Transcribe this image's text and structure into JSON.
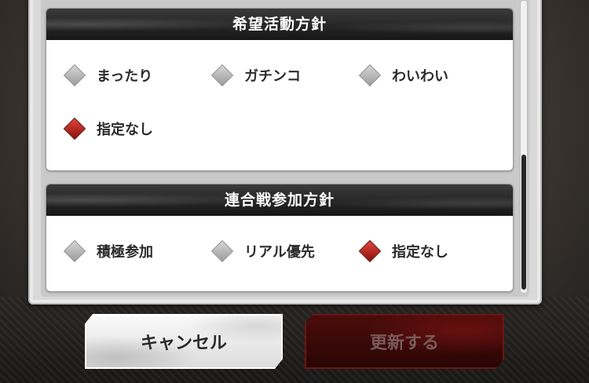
{
  "activity_policy": {
    "title": "希望活動方針",
    "options": [
      {
        "label": "まったり",
        "selected": false
      },
      {
        "label": "ガチンコ",
        "selected": false
      },
      {
        "label": "わいわい",
        "selected": false
      },
      {
        "label": "指定なし",
        "selected": true
      }
    ]
  },
  "battle_policy": {
    "title": "連合戦参加方針",
    "options": [
      {
        "label": "積極参加",
        "selected": false
      },
      {
        "label": "リアル優先",
        "selected": false
      },
      {
        "label": "指定なし",
        "selected": true
      }
    ]
  },
  "buttons": {
    "cancel_label": "キャンセル",
    "update_label": "更新する"
  },
  "colors": {
    "selected_diamond": "#b5201a",
    "unselected_diamond": "#b4b4b4",
    "header_bg": "#1e1e1e"
  }
}
